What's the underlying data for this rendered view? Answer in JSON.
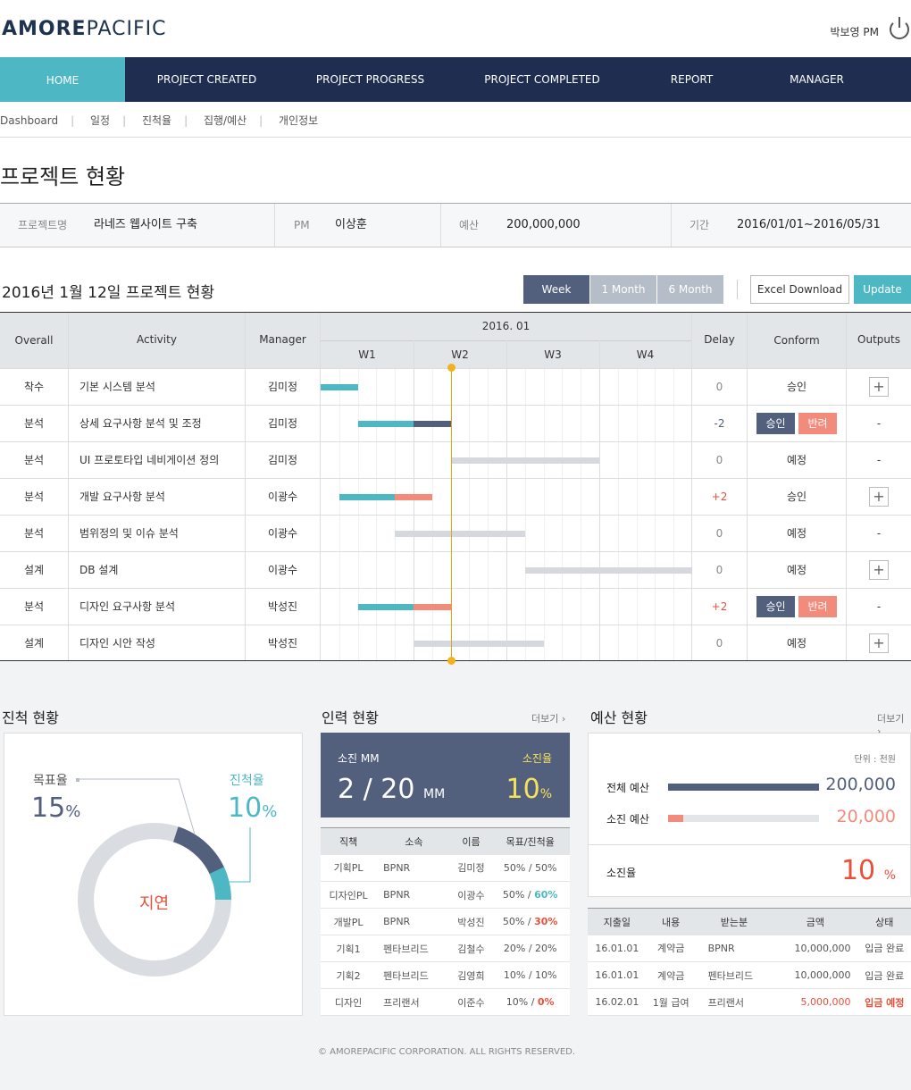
{
  "logo": {
    "bold": "AMORE",
    "rest": "PACIFIC"
  },
  "user": {
    "name": "박보영 PM"
  },
  "nav": [
    {
      "label": "HOME"
    },
    {
      "label": "PROJECT CREATED"
    },
    {
      "label": "PROJECT PROGRESS"
    },
    {
      "label": "PROJECT COMPLETED"
    },
    {
      "label": "REPORT"
    },
    {
      "label": "MANAGER"
    }
  ],
  "subnav": [
    "Dashboard",
    "일정",
    "진척율",
    "집행/예산",
    "개인정보"
  ],
  "page_title": "프로젝트 현황",
  "info": {
    "project_key": "프로젝트명",
    "project_val": "라네즈 웹사이트 구축",
    "pm_key": "PM",
    "pm_val": "이상훈",
    "budget_key": "예산",
    "budget_val": "200,000,000",
    "period_key": "기간",
    "period_val": "2016/01/01~2016/05/31"
  },
  "status_title": "2016년 1월 12일 프로젝트 현황",
  "buttons": {
    "week": "Week",
    "month1": "1 Month",
    "month6": "6 Month",
    "excel": "Excel Download",
    "update": "Update"
  },
  "gantt_head": {
    "overall": "Overall",
    "activity": "Activity",
    "manager": "Manager",
    "month": "2016. 01",
    "weeks": [
      "W1",
      "W2",
      "W3",
      "W4"
    ],
    "delay": "Delay",
    "conform": "Conform",
    "outputs": "Outputs"
  },
  "gantt_rows": [
    {
      "overall": "착수",
      "activity": "기본 시스템 분석",
      "manager": "김미정",
      "delay": "0",
      "conform": "승인",
      "output": "+",
      "bars": [
        {
          "s": 0,
          "e": 0.4,
          "c": "#4db8c4"
        }
      ]
    },
    {
      "overall": "분석",
      "activity": "상세 요구사항 분석 및 조정",
      "manager": "김미정",
      "delay": "-2",
      "conform_buttons": [
        "승인",
        "반려"
      ],
      "output": "-",
      "bars": [
        {
          "s": 0.4,
          "e": 1.0,
          "c": "#4db8c4"
        },
        {
          "s": 1.0,
          "e": 1.4,
          "c": "#52607e"
        }
      ]
    },
    {
      "overall": "분석",
      "activity": "UI 프로토타입 네비게이션 정의",
      "manager": "김미정",
      "delay": "0",
      "conform": "예정",
      "output": "-",
      "bars": [
        {
          "s": 1.4,
          "e": 3.0,
          "c": "#d5d9dd"
        }
      ]
    },
    {
      "overall": "분석",
      "activity": "개발 요구사항 분석",
      "manager": "이광수",
      "delay": "+2",
      "conform": "승인",
      "output": "+",
      "bars": [
        {
          "s": 0.2,
          "e": 0.8,
          "c": "#4db8c4"
        },
        {
          "s": 0.8,
          "e": 1.2,
          "c": "#f28b7c"
        }
      ]
    },
    {
      "overall": "분석",
      "activity": "범위정의 및 이슈 분석",
      "manager": "이광수",
      "delay": "0",
      "conform": "예정",
      "output": "-",
      "bars": [
        {
          "s": 0.8,
          "e": 2.2,
          "c": "#d5d9dd"
        }
      ]
    },
    {
      "overall": "설계",
      "activity": "DB 설계",
      "manager": "이광수",
      "delay": "0",
      "conform": "예정",
      "output": "+",
      "bars": [
        {
          "s": 2.2,
          "e": 4.0,
          "c": "#d5d9dd"
        }
      ]
    },
    {
      "overall": "분석",
      "activity": "디자인 요구사항 분석",
      "manager": "박성진",
      "delay": "+2",
      "conform_buttons": [
        "승인",
        "반려"
      ],
      "output": "-",
      "bars": [
        {
          "s": 0.4,
          "e": 1.0,
          "c": "#4db8c4"
        },
        {
          "s": 1.0,
          "e": 1.4,
          "c": "#f28b7c"
        }
      ]
    },
    {
      "overall": "설계",
      "activity": "디자인 시안 작성",
      "manager": "박성진",
      "delay": "0",
      "conform": "예정",
      "output": "+",
      "bars": [
        {
          "s": 1.0,
          "e": 2.4,
          "c": "#d5d9dd"
        }
      ]
    }
  ],
  "today_week": 1.4,
  "progress": {
    "title": "진척 현황",
    "target_label": "목표율",
    "target_value": "15",
    "actual_label": "진척율",
    "actual_value": "10",
    "pct": "%",
    "status": "지연",
    "target_frac": 0.15,
    "actual_frac": 0.1
  },
  "manpower": {
    "title": "인력 현황",
    "more": "더보기",
    "mm_label": "소진 MM",
    "mm_value": "2 / 20",
    "mm_unit": "MM",
    "rate_label": "소진율",
    "rate_value": "10",
    "rate_unit": "%",
    "headers": [
      "직책",
      "소속",
      "이름",
      "목표/진척율"
    ],
    "rows": [
      [
        "기획PL",
        "BPNR",
        "김미정",
        "50% / ",
        "50%"
      ],
      [
        "디자인PL",
        "BPNR",
        "이광수",
        "50% / ",
        "60%"
      ],
      [
        "개발PL",
        "BPNR",
        "박성진",
        "50% / ",
        "30%"
      ],
      [
        "기획1",
        "펜타브리드",
        "김철수",
        "20% / ",
        "20%"
      ],
      [
        "기획2",
        "펜타브리드",
        "김영희",
        "10% / ",
        "10%"
      ],
      [
        "디자인",
        "프리랜서",
        "이준수",
        "10% / ",
        "0%"
      ]
    ],
    "colors": [
      "#555",
      "#4db8c4",
      "#e8503a",
      "#555",
      "#555",
      "#e8503a"
    ]
  },
  "budget": {
    "title": "예산 현황",
    "more": "더보기",
    "unit": "단위 : 천원",
    "total_label": "전체 예산",
    "total_value": "200,000",
    "used_label": "소진 예산",
    "used_value": "20,000",
    "used_frac": 0.1,
    "rate_label": "소진율",
    "rate_value": "10",
    "rate_unit": "%",
    "headers": [
      "지출일",
      "내용",
      "받는분",
      "금액",
      "상태"
    ],
    "rows": [
      [
        "16.01.01",
        "계약금",
        "BPNR",
        "10,000,000",
        "입금 완료"
      ],
      [
        "16.01.01",
        "계약금",
        "펜타브리드",
        "10,000,000",
        "입금 완료"
      ],
      [
        "16.02.01",
        "1월 급여",
        "프리랜서",
        "5,000,000",
        "입금 예정"
      ]
    ]
  },
  "footer": "© AMOREPACIFIC CORPORATION. ALL RIGHTS RESERVED."
}
